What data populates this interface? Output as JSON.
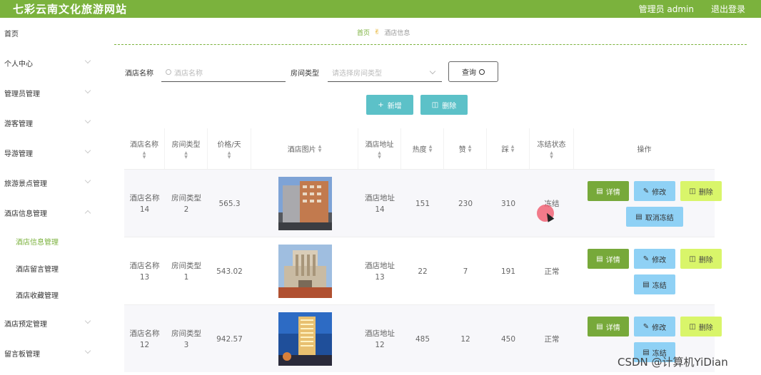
{
  "app": {
    "title": "七彩云南文化旅游网站",
    "user_label": "管理员 admin",
    "logout_label": "退出登录"
  },
  "sidebar": {
    "items": [
      {
        "label": "首页",
        "chevron": false
      },
      {
        "label": "个人中心",
        "chevron": true
      },
      {
        "label": "管理员管理",
        "chevron": true
      },
      {
        "label": "游客管理",
        "chevron": true
      },
      {
        "label": "导游管理",
        "chevron": true
      },
      {
        "label": "旅游景点管理",
        "chevron": true
      },
      {
        "label": "酒店信息管理",
        "chevron": true,
        "open": true
      },
      {
        "label": "酒店预定管理",
        "chevron": true
      },
      {
        "label": "留言板管理",
        "chevron": true
      }
    ],
    "submenu": [
      {
        "label": "酒店信息管理",
        "active": true
      },
      {
        "label": "酒店留言管理",
        "active": false
      },
      {
        "label": "酒店收藏管理",
        "active": false
      }
    ]
  },
  "breadcrumb": {
    "home": "首页",
    "current": "酒店信息",
    "icon": "hand-icon"
  },
  "filters": {
    "name_label": "酒店名称",
    "name_placeholder": "酒店名称",
    "type_label": "房间类型",
    "type_placeholder": "请选择房间类型",
    "query_label": "查询"
  },
  "actions": {
    "add_label": "新增",
    "delete_label": "删除"
  },
  "table": {
    "headers": [
      "酒店名称",
      "房间类型",
      "价格/天",
      "酒店图片",
      "酒店地址",
      "热度",
      "赞",
      "踩",
      "冻结状态",
      "操作"
    ],
    "rows": [
      {
        "name": "酒店名称\n14",
        "type": "房间类型\n2",
        "price": "565.3",
        "address": "酒店地址\n14",
        "heat": "151",
        "likes": "230",
        "dislikes": "310",
        "status": "冻结",
        "freeze_btn": "取消冻结",
        "img": "hotel-14"
      },
      {
        "name": "酒店名称\n13",
        "type": "房间类型\n1",
        "price": "543.02",
        "address": "酒店地址\n13",
        "heat": "22",
        "likes": "7",
        "dislikes": "191",
        "status": "正常",
        "freeze_btn": "冻结",
        "img": "hotel-13"
      },
      {
        "name": "酒店名称\n12",
        "type": "房间类型\n3",
        "price": "942.57",
        "address": "酒店地址\n12",
        "heat": "485",
        "likes": "12",
        "dislikes": "450",
        "status": "正常",
        "freeze_btn": "冻结",
        "img": "hotel-12"
      }
    ],
    "op_labels": {
      "detail": "详情",
      "edit": "修改",
      "delete": "删除"
    }
  },
  "watermark": "CSDN @计算机YiDian",
  "colors": {
    "brand": "#7bb23d",
    "teal": "#5cc1c8",
    "detail": "#77a93a",
    "edit": "#8fd1f5",
    "delete": "#d9f56a"
  }
}
